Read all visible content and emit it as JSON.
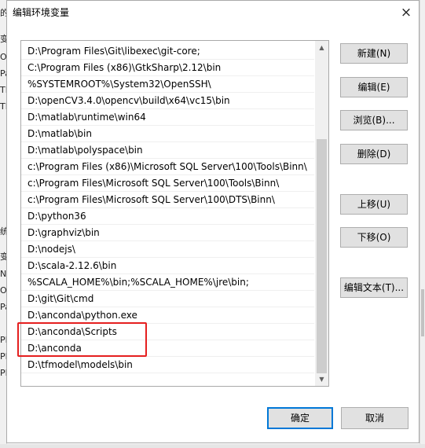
{
  "background_window": {
    "left_edge_chars": [
      "的",
      "变",
      "O",
      "Pa",
      "TE",
      "TI",
      "统",
      "变",
      "N",
      "O",
      "Pa",
      "PF",
      "PF",
      "PF"
    ]
  },
  "dialog": {
    "title": "编辑环境变量",
    "close_icon": "×",
    "entries": [
      "D:\\Program Files\\Git\\libexec\\git-core;",
      "C:\\Program Files (x86)\\GtkSharp\\2.12\\bin",
      "%SYSTEMROOT%\\System32\\OpenSSH\\",
      "D:\\openCV3.4.0\\opencv\\build\\x64\\vc15\\bin",
      "D:\\matlab\\runtime\\win64",
      "D:\\matlab\\bin",
      "D:\\matlab\\polyspace\\bin",
      "c:\\Program Files (x86)\\Microsoft SQL Server\\100\\Tools\\Binn\\",
      "c:\\Program Files\\Microsoft SQL Server\\100\\Tools\\Binn\\",
      "c:\\Program Files\\Microsoft SQL Server\\100\\DTS\\Binn\\",
      "D:\\python36",
      "D:\\graphviz\\bin",
      "D:\\nodejs\\",
      "D:\\scala-2.12.6\\bin",
      "%SCALA_HOME%\\bin;%SCALA_HOME%\\jre\\bin;",
      "D:\\git\\Git\\cmd",
      "D:\\anconda\\python.exe",
      "D:\\anconda\\Scripts",
      "D:\\anconda",
      "D:\\tfmodel\\models\\bin"
    ],
    "buttons": {
      "new": "新建(N)",
      "edit": "编辑(E)",
      "browse": "浏览(B)...",
      "delete": "删除(D)",
      "move_up": "上移(U)",
      "move_down": "下移(O)",
      "edit_text": "编辑文本(T)...",
      "ok": "确定",
      "cancel": "取消"
    },
    "highlight_color": "#e51f1f",
    "accent_color": "#0078d7"
  }
}
